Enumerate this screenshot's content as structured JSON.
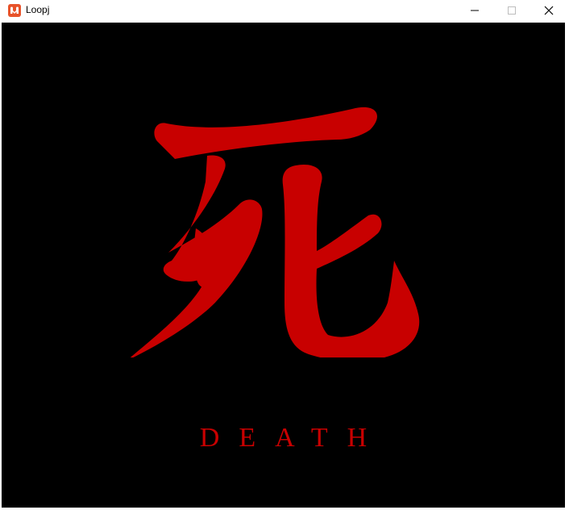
{
  "window": {
    "title": "Loopj",
    "icon": "monogame-icon",
    "controls": [
      "minimize-icon",
      "maximize-icon",
      "close-icon"
    ]
  },
  "content": {
    "kanji": "死",
    "caption": "DEATH",
    "background_color": "#000000",
    "accent_color": "#cc0000"
  }
}
